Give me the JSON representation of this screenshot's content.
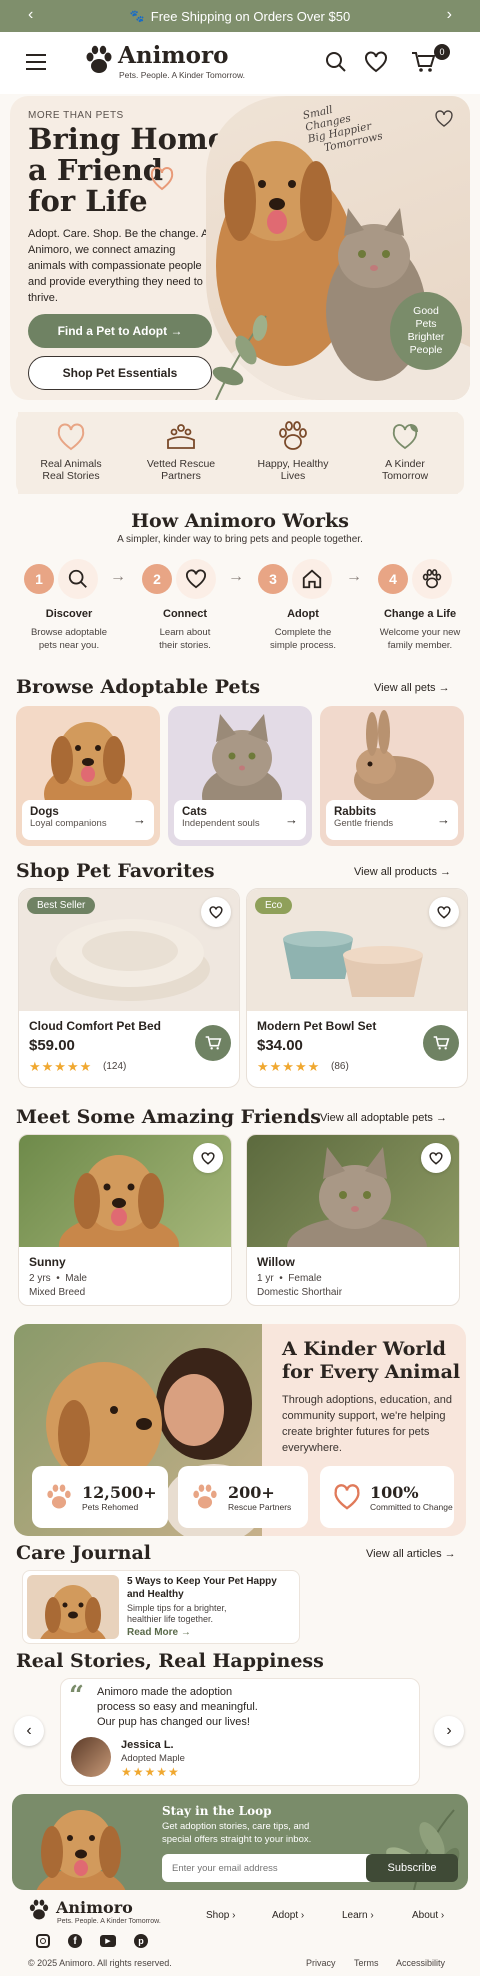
{
  "announcement": {
    "text": "Free Shipping on Orders Over $50"
  },
  "brand": {
    "name": "Animoro",
    "tagline": "Pets. People. A Kinder Tomorrow.",
    "cart_count": "0"
  },
  "hero": {
    "eyebrow": "MORE THAN PETS",
    "title_line1": "Bring Home",
    "title_line2": "a Friend",
    "title_line3": "for Life",
    "body": "Adopt. Care. Shop. Be the change. At Animoro, we connect amazing animals with compassionate people and provide everything they need to thrive.",
    "cta_primary": "Find a Pet to Adopt →",
    "cta_secondary": "Shop Pet Essentials",
    "handwritten_1": "Small",
    "handwritten_2": "Changes",
    "handwritten_3": "Big Happier",
    "handwritten_4": "Tomorrows",
    "bubble_1": "Good",
    "bubble_2": "Pets",
    "bubble_3": "Brighter",
    "bubble_4": "People"
  },
  "features": [
    {
      "line1": "Real Animals",
      "line2": "Real Stories",
      "icon": "heart-icon"
    },
    {
      "line1": "Vetted Rescue",
      "line2": "Partners",
      "icon": "handshake-paw-icon"
    },
    {
      "line1": "Happy, Healthy",
      "line2": "Lives",
      "icon": "paw-icon"
    },
    {
      "line1": "A Kinder",
      "line2": "Tomorrow",
      "icon": "leaf-heart-icon"
    }
  ],
  "how": {
    "title": "How Animoro Works",
    "subtitle": "A simpler, kinder way to bring pets and people together.",
    "steps": [
      {
        "num": "1",
        "title": "Discover",
        "l1": "Browse adoptable",
        "l2": "pets near you.",
        "icon": "search-icon"
      },
      {
        "num": "2",
        "title": "Connect",
        "l1": "Learn about",
        "l2": "their stories.",
        "icon": "heart-icon"
      },
      {
        "num": "3",
        "title": "Adopt",
        "l1": "Complete the",
        "l2": "simple process.",
        "icon": "home-icon"
      },
      {
        "num": "4",
        "title": "Change a Life",
        "l1": "Welcome your new",
        "l2": "family member.",
        "icon": "paw-icon"
      }
    ]
  },
  "browse": {
    "title": "Browse Adoptable Pets",
    "view_all": "View all pets →",
    "items": [
      {
        "title": "Dogs",
        "sub": "Loyal companions"
      },
      {
        "title": "Cats",
        "sub": "Independent souls"
      },
      {
        "title": "Rabbits",
        "sub": "Gentle friends"
      }
    ]
  },
  "shop": {
    "title": "Shop Pet Favorites",
    "view_all": "View all products →",
    "products": [
      {
        "badge": "Best Seller",
        "name": "Cloud Comfort Pet Bed",
        "price": "$59.00",
        "stars": "★★★★★",
        "reviews": "(124)",
        "badge_color": "#6f8263"
      },
      {
        "badge": "Eco",
        "name": "Modern Pet Bowl Set",
        "price": "$34.00",
        "stars": "★★★★★",
        "reviews": "(86)",
        "badge_color": "#8fa05a"
      }
    ]
  },
  "friends": {
    "title": "Meet Some Amazing Friends",
    "view_all": "View all adoptable pets →",
    "pets": [
      {
        "name": "Sunny",
        "age": "2 yrs",
        "sex": "Male",
        "breed": "Mixed Breed"
      },
      {
        "name": "Willow",
        "age": "1 yr",
        "sex": "Female",
        "breed": "Domestic Shorthair"
      }
    ]
  },
  "kinder": {
    "title_line1": "A Kinder World",
    "title_line2": "for Every Animal",
    "body": "Through adoptions, education, and community support, we're helping create brighter futures for pets everywhere.",
    "stats": [
      {
        "num": "12,500+",
        "label": "Pets Rehomed"
      },
      {
        "num": "200+",
        "label": "Rescue Partners"
      },
      {
        "num": "100%",
        "label": "Committed to Change"
      }
    ]
  },
  "journal": {
    "title": "Care Journal",
    "view_all": "View all articles →",
    "article_title": "5 Ways to Keep Your Pet Happy and Healthy",
    "article_sub": "Simple tips for a brighter, healthier life together.",
    "read_more": "Read More →"
  },
  "stories": {
    "title": "Real Stories, Real Happiness",
    "quote": "Animoro made the adoption process so easy and meaningful. Our pup has changed our lives!",
    "author": "Jessica L.",
    "author_sub": "Adopted Maple",
    "stars": "★★★★★"
  },
  "newsletter": {
    "title": "Stay in the Loop",
    "body": "Get adoption stories, care tips, and special offers straight to your inbox.",
    "placeholder": "Enter your email address",
    "button": "Subscribe"
  },
  "footer": {
    "nav": [
      "Shop ›",
      "Adopt ›",
      "Learn ›",
      "About ›"
    ],
    "copyright": "© 2025 Animoro. All rights reserved.",
    "links": [
      "Privacy",
      "Terms",
      "Accessibility"
    ]
  }
}
